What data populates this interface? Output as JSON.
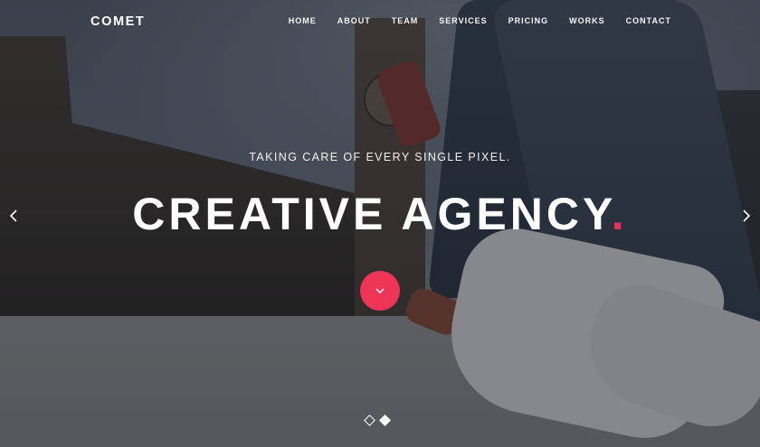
{
  "brand": {
    "logo": "COMET"
  },
  "nav": {
    "items": [
      {
        "label": "HOME"
      },
      {
        "label": "ABOUT"
      },
      {
        "label": "TEAM"
      },
      {
        "label": "SERVICES"
      },
      {
        "label": "PRICING"
      },
      {
        "label": "WORKS"
      },
      {
        "label": "CONTACT"
      }
    ]
  },
  "hero": {
    "tagline": "TAKING CARE OF EVERY SINGLE PIXEL.",
    "headline": "CREATIVE AGENCY",
    "headline_dot": ".",
    "accent_color": "#ee3457"
  },
  "controls": {
    "prev_icon": "chevron-left-icon",
    "next_icon": "chevron-right-icon",
    "scroll_icon": "chevron-down-icon",
    "slides": [
      {
        "active": false
      },
      {
        "active": true
      }
    ]
  }
}
